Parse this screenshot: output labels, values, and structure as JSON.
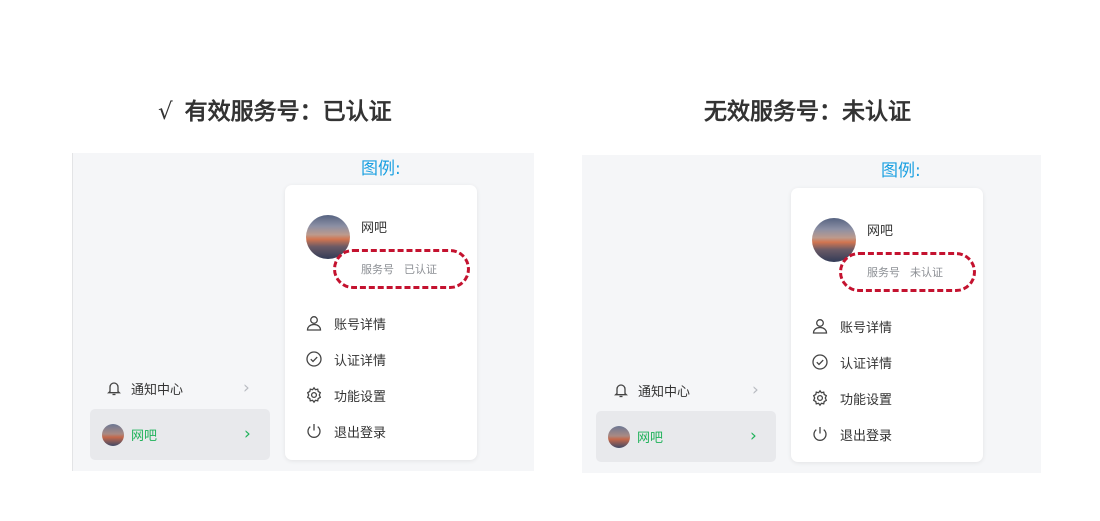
{
  "left_heading": {
    "check": "√",
    "text": "有效服务号：已认证"
  },
  "right_heading": {
    "text": "无效服务号：未认证"
  },
  "left": {
    "legend": "图例:",
    "sidebar": {
      "notify": "通知中心",
      "user": "网吧"
    },
    "card": {
      "name": "网吧",
      "badge_type": "服务号",
      "badge_status": "已认证",
      "menu": [
        {
          "icon": "user-icon",
          "label": "账号详情"
        },
        {
          "icon": "check-circle-icon",
          "label": "认证详情"
        },
        {
          "icon": "gear-icon",
          "label": "功能设置"
        },
        {
          "icon": "power-icon",
          "label": "退出登录"
        }
      ]
    }
  },
  "right": {
    "legend": "图例:",
    "sidebar": {
      "notify": "通知中心",
      "user": "网吧"
    },
    "card": {
      "name": "网吧",
      "badge_type": "服务号",
      "badge_status": "未认证",
      "menu": [
        {
          "icon": "user-icon",
          "label": "账号详情"
        },
        {
          "icon": "check-circle-icon",
          "label": "认证详情"
        },
        {
          "icon": "gear-icon",
          "label": "功能设置"
        },
        {
          "icon": "power-icon",
          "label": "退出登录"
        }
      ]
    }
  },
  "colors": {
    "accent_green": "#1fb25a",
    "legend_blue": "#1ba0e1",
    "highlight_red": "#c4122f"
  }
}
